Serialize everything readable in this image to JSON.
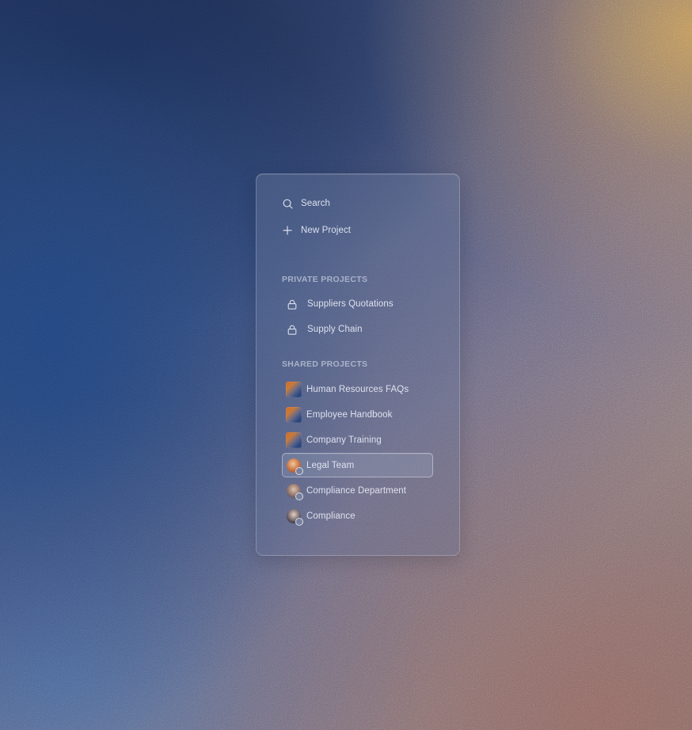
{
  "menu": {
    "search_label": "Search",
    "new_project_label": "New Project"
  },
  "private_projects": {
    "title": "PRIVATE PROJECTS",
    "items": [
      {
        "label": "Suppliers Quotations",
        "icon": "lock-icon"
      },
      {
        "label": "Supply Chain",
        "icon": "lock-icon"
      }
    ]
  },
  "shared_projects": {
    "title": "SHARED PROJECTS",
    "items": [
      {
        "label": "Human Resources FAQs",
        "icon": "project-thumbnail"
      },
      {
        "label": "Employee Handbook",
        "icon": "project-thumbnail"
      },
      {
        "label": "Company Training",
        "icon": "project-thumbnail"
      },
      {
        "label": "Legal Team",
        "icon": "user-avatar",
        "selected": true
      },
      {
        "label": "Compliance Department",
        "icon": "user-avatar"
      },
      {
        "label": "Compliance",
        "icon": "user-avatar"
      }
    ]
  },
  "colors": {
    "text": "#E8ECF6",
    "section_title": "#C8CEE0",
    "thumbnail_orange": "#D26A2A",
    "thumbnail_blue": "#24407A"
  }
}
